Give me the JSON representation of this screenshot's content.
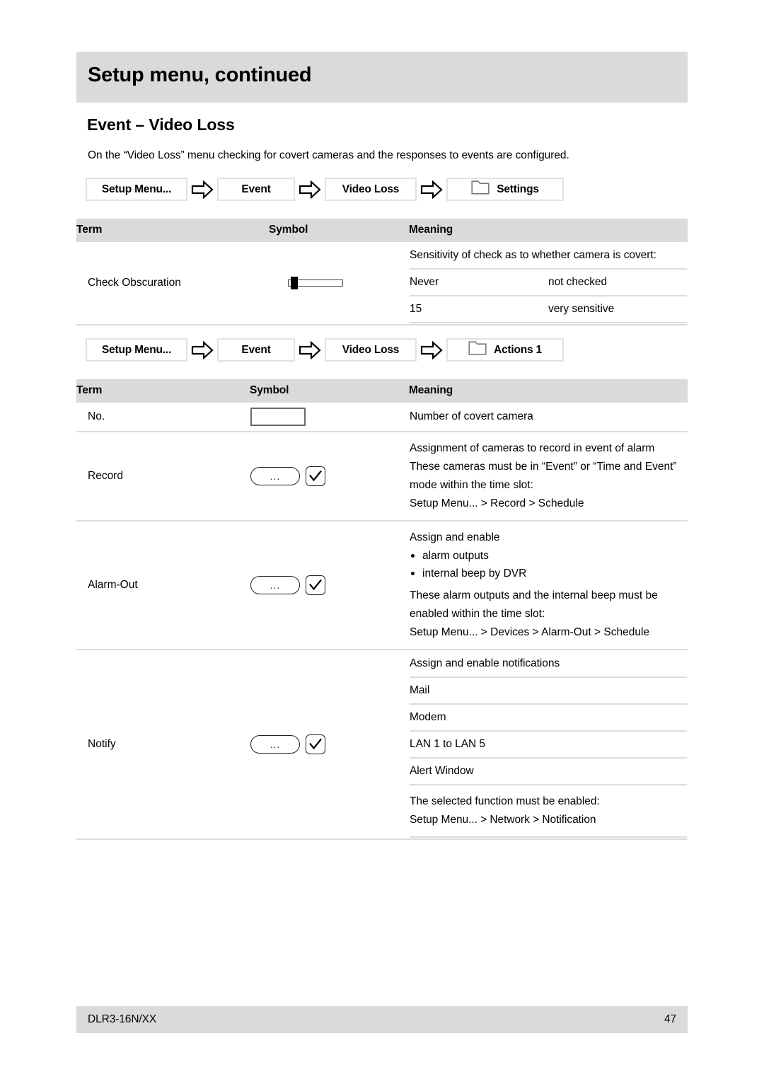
{
  "header": {
    "title": "Setup menu, continued"
  },
  "section": {
    "heading": "Event – Video Loss",
    "intro": "On the “Video Loss” menu checking for covert cameras and the responses to events are configured."
  },
  "breadcrumbs": [
    {
      "id": "settings",
      "items": [
        "Setup Menu...",
        "Event",
        "Video Loss",
        "Settings"
      ],
      "arrow_icon": "right-block-arrow-icon",
      "leaf_icon": "folder-icon"
    },
    {
      "id": "actions1",
      "items": [
        "Setup Menu...",
        "Event",
        "Video Loss",
        "Actions 1"
      ],
      "arrow_icon": "right-block-arrow-icon",
      "leaf_icon": "folder-icon"
    }
  ],
  "table_settings": {
    "columns": [
      "Term",
      "Symbol",
      "Meaning"
    ],
    "rows": [
      {
        "term": "Check Obscuration",
        "symbol_icon": "slider-icon",
        "meaning_intro": "Sensitivity of check as to whether camera is covert:",
        "options": [
          {
            "value": "Never",
            "description": "not checked"
          },
          {
            "value": "15",
            "description": "very sensitive"
          }
        ]
      }
    ]
  },
  "table_actions": {
    "columns": [
      "Term",
      "Symbol",
      "Meaning"
    ],
    "rows": [
      {
        "term": "No.",
        "symbol_icon": "text-input-icon",
        "meaning_lines": [
          "Number of covert camera"
        ]
      },
      {
        "term": "Record",
        "symbol_icon": "dots-button-and-checkbox-icon",
        "meaning_lines": [
          "Assignment of cameras to record in event of alarm",
          "These cameras must be in “Event” or “Time and Event” mode within the time slot:",
          "Setup Menu... > Record > Schedule"
        ]
      },
      {
        "term": "Alarm-Out",
        "symbol_icon": "dots-button-and-checkbox-icon",
        "meaning_intro": "Assign and enable",
        "bullets": [
          "alarm outputs",
          "internal beep by DVR"
        ],
        "meaning_lines": [
          "These alarm outputs and the internal beep must be enabled within the time slot:",
          "Setup Menu... > Devices > Alarm-Out > Schedule"
        ]
      },
      {
        "term": "Notify",
        "symbol_icon": "dots-button-and-checkbox-icon",
        "sub_rows": [
          "Assign and enable notifications",
          "Mail",
          "Modem",
          "LAN 1 to LAN 5",
          "Alert Window"
        ],
        "meaning_lines": [
          "The selected function must be enabled:",
          "Setup Menu... > Network > Notification"
        ]
      }
    ]
  },
  "footer": {
    "model": "DLR3-16N/XX",
    "page_number": "47"
  },
  "colors": {
    "band": "#d9dadb",
    "rule": "#dcdcdc",
    "text": "#000000"
  }
}
